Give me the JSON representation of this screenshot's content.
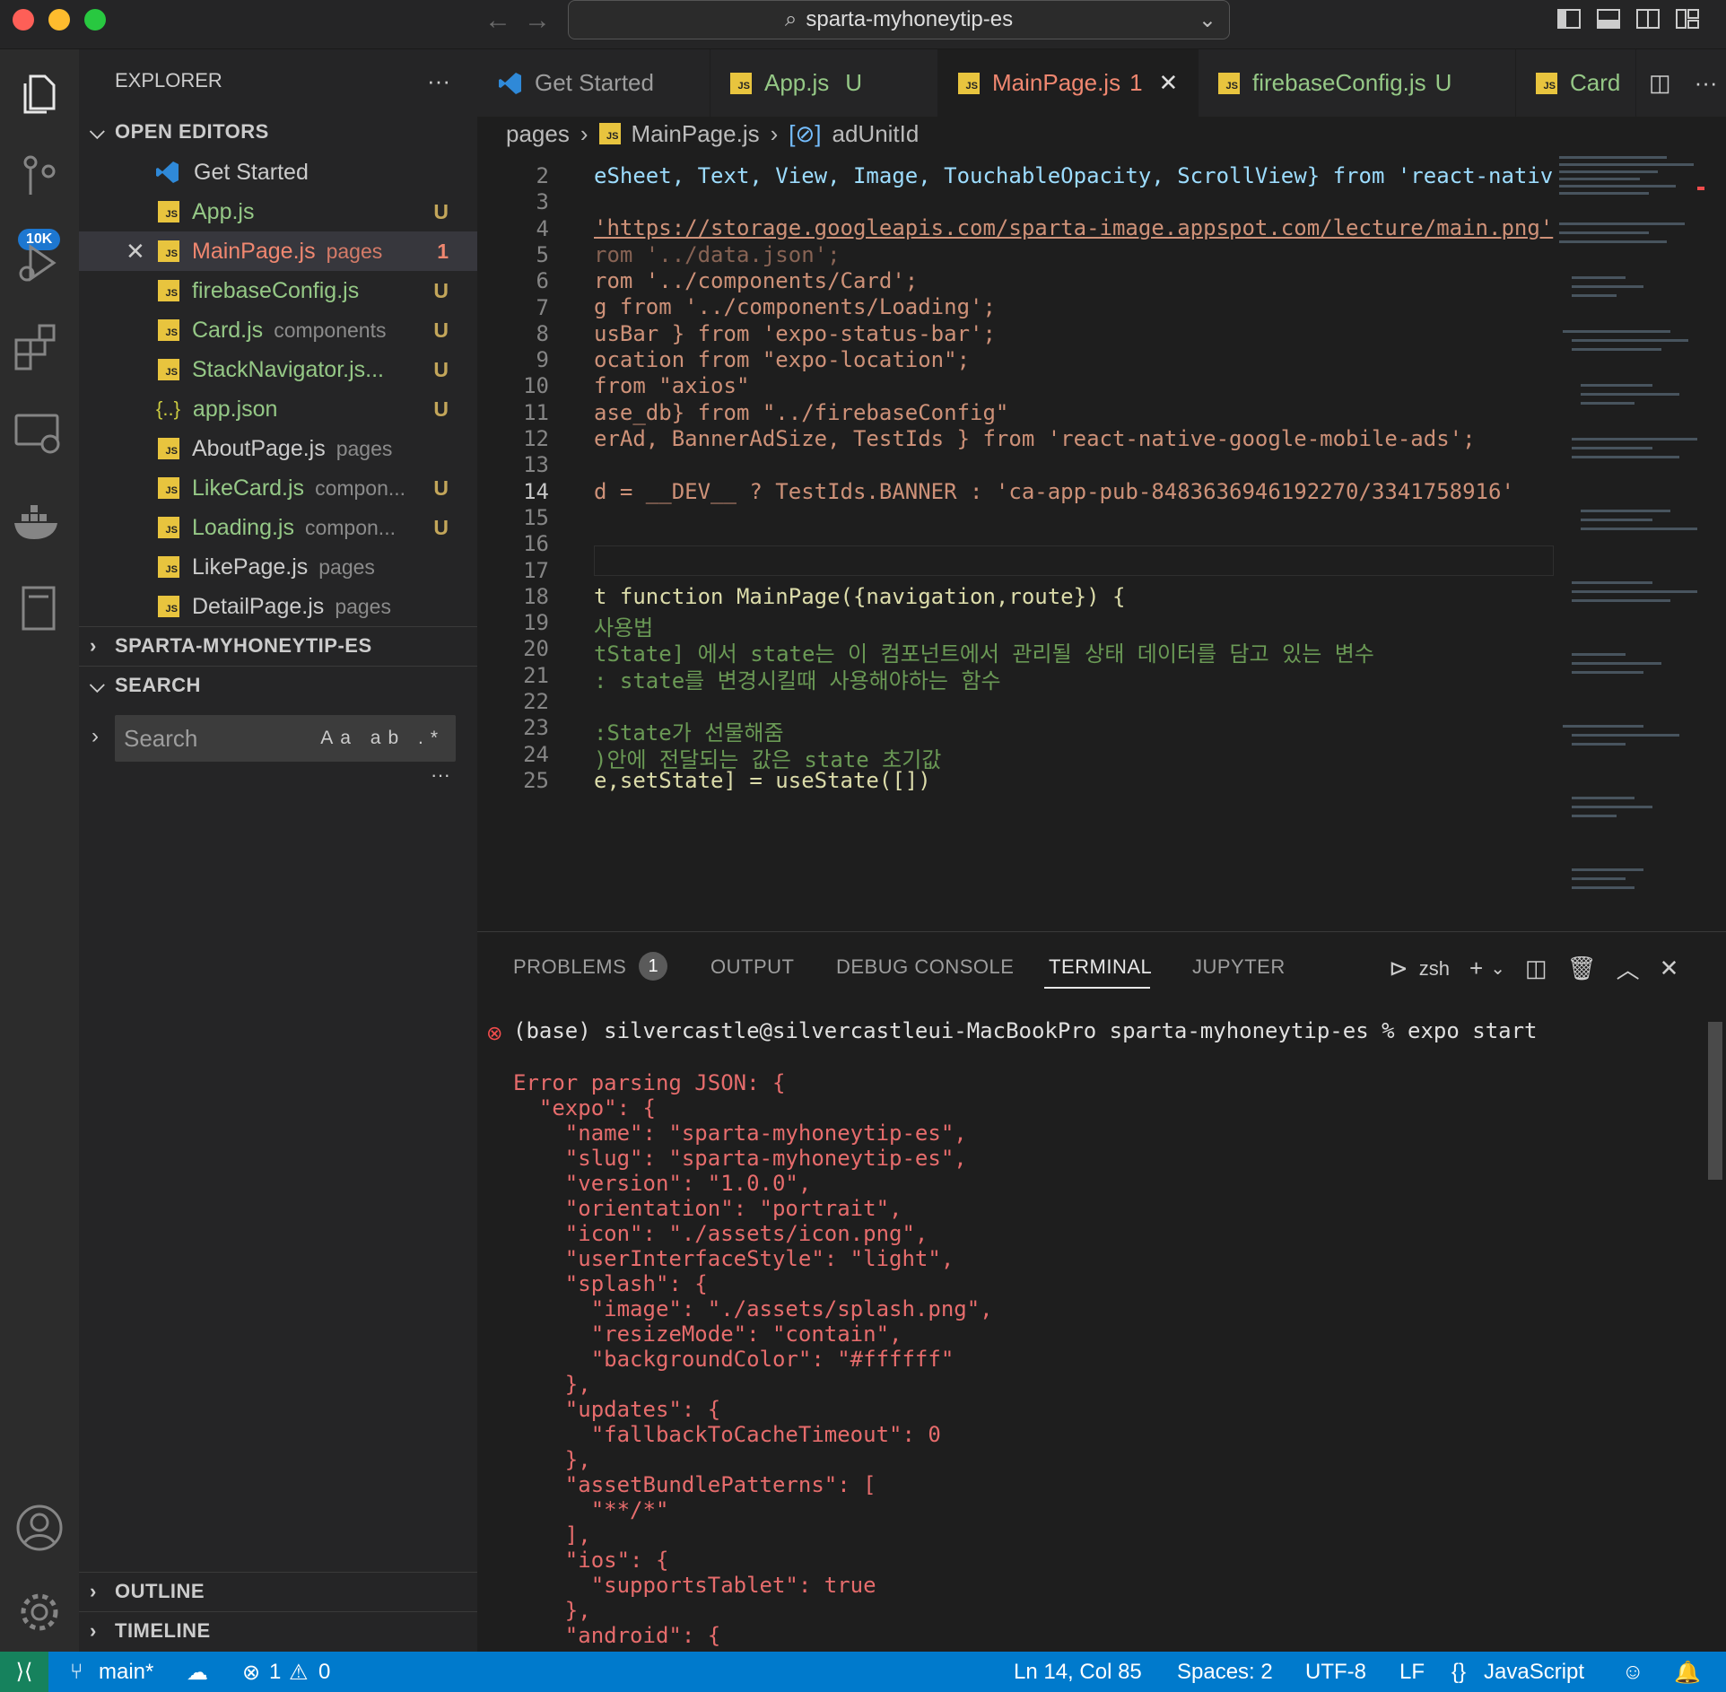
{
  "window": {
    "title": "sparta-myhoneytip-es"
  },
  "explorer": {
    "title": "EXPLORER",
    "open_editors_label": "OPEN EDITORS",
    "open_editors": [
      {
        "name": "Get Started",
        "tag": "",
        "status": ""
      },
      {
        "name": "App.js",
        "tag": "",
        "status": "U"
      },
      {
        "name": "MainPage.js",
        "tag": "pages",
        "status": "1"
      },
      {
        "name": "firebaseConfig.js",
        "tag": "",
        "status": "U"
      },
      {
        "name": "Card.js",
        "tag": "components",
        "status": "U"
      },
      {
        "name": "StackNavigator.js...",
        "tag": "",
        "status": "U"
      },
      {
        "name": "app.json",
        "tag": "",
        "status": "U"
      },
      {
        "name": "AboutPage.js",
        "tag": "pages",
        "status": ""
      },
      {
        "name": "LikeCard.js",
        "tag": "compon...",
        "status": "U"
      },
      {
        "name": "Loading.js",
        "tag": "compon...",
        "status": "U"
      },
      {
        "name": "LikePage.js",
        "tag": "pages",
        "status": ""
      },
      {
        "name": "DetailPage.js",
        "tag": "pages",
        "status": ""
      }
    ],
    "folder_label": "SPARTA-MYHONEYTIP-ES",
    "search_label": "SEARCH",
    "search_placeholder": "Search",
    "search_opts": "Aa ab .*",
    "outline_label": "OUTLINE",
    "timeline_label": "TIMELINE",
    "scm_badge": "10K"
  },
  "tabs": [
    {
      "label": "Get Started",
      "status": ""
    },
    {
      "label": "App.js",
      "status": "U"
    },
    {
      "label": "MainPage.js",
      "status": "1"
    },
    {
      "label": "firebaseConfig.js",
      "status": "U"
    },
    {
      "label": "Card",
      "status": ""
    }
  ],
  "breadcrumb": {
    "folder": "pages",
    "file": "MainPage.js",
    "symbol": "adUnitId"
  },
  "editor": {
    "line_numbers": [
      "2",
      "3",
      "4",
      "5",
      "6",
      "7",
      "8",
      "9",
      "10",
      "11",
      "12",
      "13",
      "14",
      "15",
      "16",
      "17",
      "18",
      "19",
      "20",
      "21",
      "22",
      "23",
      "24",
      "25"
    ],
    "line_2": "eSheet, Text, View, Image, TouchableOpacity, ScrollView} from 'react-nativ",
    "line_4": "'https://storage.googleapis.com/sparta-image.appspot.com/lecture/main.png'",
    "line_5": "rom '../data.json';",
    "line_6": "rom '../components/Card';",
    "line_7": "g from '../components/Loading';",
    "line_8": "usBar } from 'expo-status-bar';",
    "line_9": "ocation from \"expo-location\";",
    "line_10": "from \"axios\"",
    "line_11": "ase_db} from \"../firebaseConfig\"",
    "line_12": "erAd, BannerAdSize, TestIds } from 'react-native-google-mobile-ads';",
    "line_14": "d = __DEV__ ? TestIds.BANNER : 'ca-app-pub-8483636946192270/3341758916'",
    "line_18": "t function MainPage({navigation,route}) {",
    "line_19": "사용법",
    "line_20": "tState] 에서 state는 이 컴포넌트에서 관리될 상태 데이터를 담고 있는 변수",
    "line_21": ": state를 변경시킬때 사용해야하는 함수",
    "line_23": ":State가 선물해줌",
    "line_24": ")안에 전달되는 값은 state 초기값",
    "line_25": "e,setState] = useState([])"
  },
  "panel": {
    "tabs": [
      "PROBLEMS",
      "OUTPUT",
      "DEBUG CONSOLE",
      "TERMINAL",
      "JUPYTER"
    ],
    "problems_count": "1",
    "shell": "zsh",
    "prompt": "(base) silvercastle@silvercastleui-MacBookPro sparta-myhoneytip-es % expo start",
    "output": [
      "Error parsing JSON: {",
      "  \"expo\": {",
      "    \"name\": \"sparta-myhoneytip-es\",",
      "    \"slug\": \"sparta-myhoneytip-es\",",
      "    \"version\": \"1.0.0\",",
      "    \"orientation\": \"portrait\",",
      "    \"icon\": \"./assets/icon.png\",",
      "    \"userInterfaceStyle\": \"light\",",
      "    \"splash\": {",
      "      \"image\": \"./assets/splash.png\",",
      "      \"resizeMode\": \"contain\",",
      "      \"backgroundColor\": \"#ffffff\"",
      "    },",
      "    \"updates\": {",
      "      \"fallbackToCacheTimeout\": 0",
      "    },",
      "    \"assetBundlePatterns\": [",
      "      \"**/*\"",
      "    ],",
      "    \"ios\": {",
      "      \"supportsTablet\": true",
      "    },",
      "    \"android\": {"
    ]
  },
  "status_bar": {
    "branch": "main*",
    "errors": "1",
    "warnings": "0",
    "position": "Ln 14, Col 85",
    "spaces": "Spaces: 2",
    "encoding": "UTF-8",
    "eol": "LF",
    "language": "JavaScript"
  },
  "colors": {
    "accent": "#007acc",
    "error": "#f14c4c",
    "modified": "#e6ad70",
    "untracked": "#c3a65a"
  }
}
